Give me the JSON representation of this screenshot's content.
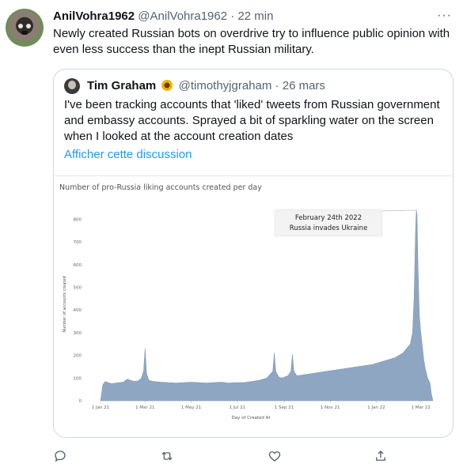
{
  "tweet": {
    "display_name": "AnilVohra1962",
    "handle": "@AnilVohra1962",
    "separator": "·",
    "time": "22 min",
    "more": "···",
    "text": "Newly created Russian bots on overdrive try to influence public opinion with even less success than the inept Russian military."
  },
  "quote": {
    "display_name": "Tim Graham",
    "handle": "@timothyjgraham",
    "separator": "·",
    "date": "26 mars",
    "text": "I've been tracking accounts that 'liked' tweets from Russian government and embassy accounts. Sprayed a bit of sparkling water on the screen when I looked at the account creation dates",
    "show_thread": "Afficher cette discussion"
  },
  "icons": {
    "reply": "reply-icon",
    "retweet": "retweet-icon",
    "like": "like-icon",
    "share": "share-icon"
  },
  "chart_data": {
    "type": "area",
    "title": "Number of pro-Russia liking accounts created per day",
    "xlabel": "Day of Created At",
    "ylabel": "Number of accounts created",
    "ylim": [
      0,
      850
    ],
    "yticks": [
      0,
      100,
      200,
      300,
      400,
      500,
      600,
      700,
      800
    ],
    "xticks": [
      "1 Jan 21",
      "1 Mar 21",
      "1 May 21",
      "1 Jul 21",
      "1 Sep 21",
      "1 Nov 21",
      "1 Jan 22",
      "1 Mar 22"
    ],
    "xtick_days": [
      0,
      59,
      120,
      181,
      243,
      304,
      365,
      424
    ],
    "xlim_days": [
      0,
      440
    ],
    "fill_color": "#8fa6c3",
    "annotation": {
      "lines": [
        "February 24th 2022",
        "Russia invades Ukraine"
      ],
      "day": 419,
      "value": 840
    },
    "series": [
      {
        "x": [
          0,
          3,
          6,
          10,
          15,
          20,
          25,
          30,
          35,
          40,
          45,
          50,
          54,
          57,
          59,
          61,
          64,
          70,
          80,
          90,
          100,
          110,
          120,
          130,
          140,
          150,
          160,
          170,
          180,
          190,
          200,
          210,
          220,
          228,
          230,
          232,
          236,
          240,
          248,
          252,
          254,
          256,
          260,
          270,
          280,
          290,
          300,
          310,
          320,
          330,
          340,
          350,
          360,
          370,
          380,
          390,
          395,
          400,
          405,
          410,
          413,
          415,
          416,
          417,
          418,
          419,
          420,
          421,
          422,
          424,
          426,
          428,
          430,
          433,
          436,
          438,
          440
        ],
        "y": [
          0,
          70,
          85,
          80,
          75,
          78,
          80,
          82,
          95,
          90,
          85,
          88,
          100,
          130,
          230,
          120,
          90,
          85,
          82,
          80,
          78,
          80,
          82,
          80,
          78,
          80,
          82,
          78,
          80,
          80,
          85,
          90,
          100,
          130,
          210,
          130,
          105,
          100,
          110,
          130,
          205,
          130,
          110,
          115,
          120,
          125,
          130,
          135,
          140,
          145,
          150,
          155,
          160,
          170,
          180,
          190,
          200,
          210,
          230,
          250,
          300,
          450,
          600,
          750,
          840,
          820,
          640,
          500,
          380,
          300,
          240,
          180,
          140,
          100,
          80,
          30,
          0
        ]
      }
    ]
  }
}
